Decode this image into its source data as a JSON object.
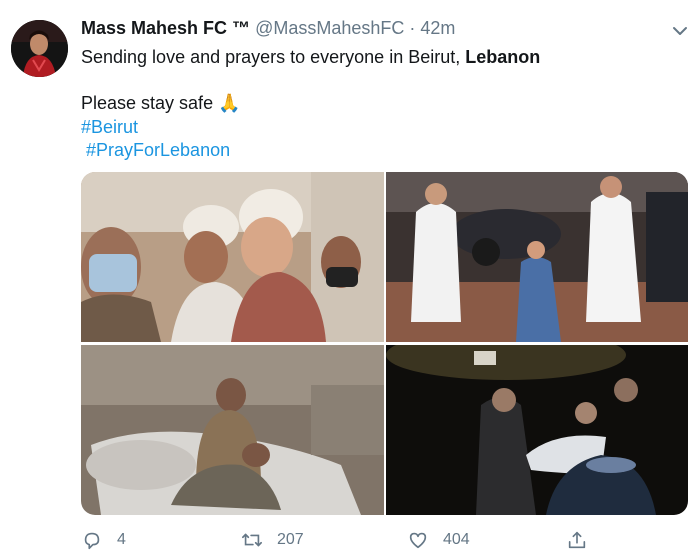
{
  "tweet": {
    "display_name": "Mass Mahesh FC ™",
    "handle": "@MassMaheshFC",
    "separator": "·",
    "time": "42m",
    "text_prefix": "Sending love and prayers to everyone in Beirut, ",
    "text_bold": "Lebanon",
    "text_line2": "Please stay safe",
    "emoji": "🙏",
    "hashtags": [
      "#Beirut",
      "#PrayForLebanon"
    ],
    "photos": [
      "injured-child-photo",
      "medics-street-photo",
      "children-rubble-photo",
      "night-rescue-photo"
    ]
  },
  "actions": {
    "reply_count": "4",
    "retweet_count": "207",
    "like_count": "404"
  },
  "colors": {
    "link": "#1b95e0",
    "secondary": "#657786",
    "text": "#14171a"
  },
  "icons": [
    "caret-down-icon",
    "reply-icon",
    "retweet-icon",
    "like-icon",
    "share-icon"
  ]
}
